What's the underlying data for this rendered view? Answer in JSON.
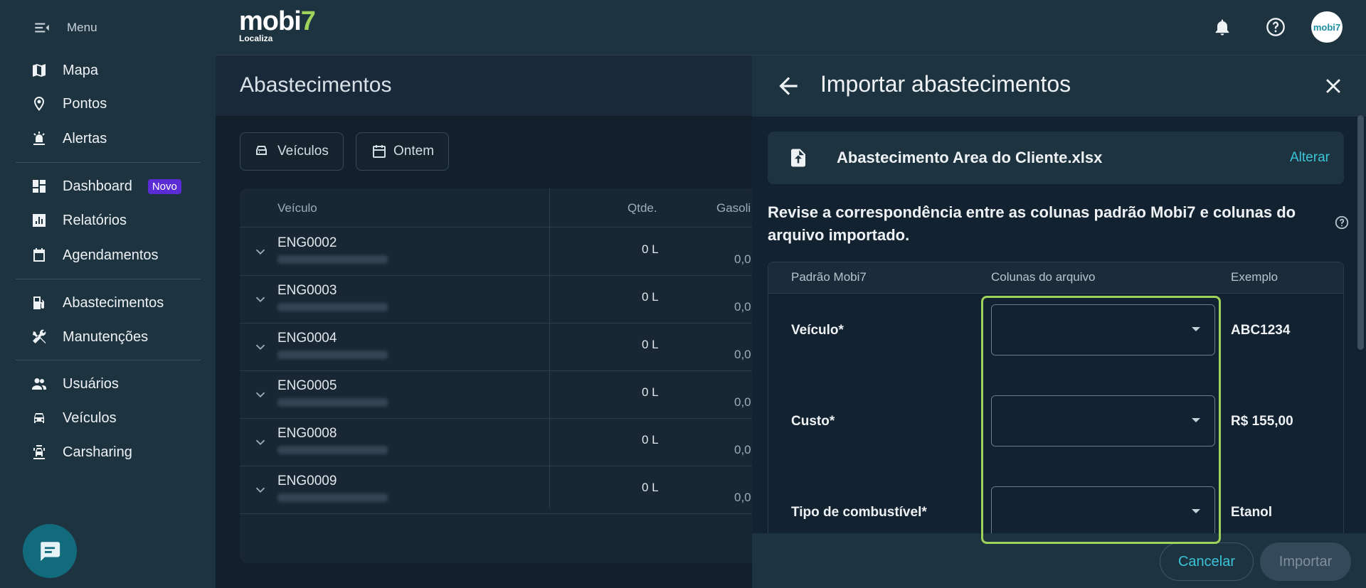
{
  "sidebar": {
    "menu_label": "Menu",
    "items": [
      {
        "label": "Mapa",
        "icon": "map-icon"
      },
      {
        "label": "Pontos",
        "icon": "pin-icon"
      },
      {
        "label": "Alertas",
        "icon": "alarm-icon"
      },
      {
        "label": "Dashboard",
        "icon": "dashboard-icon",
        "badge": "Novo"
      },
      {
        "label": "Relatórios",
        "icon": "report-icon"
      },
      {
        "label": "Agendamentos",
        "icon": "calendar-icon"
      },
      {
        "label": "Abastecimentos",
        "icon": "fuel-icon"
      },
      {
        "label": "Manutenções",
        "icon": "tools-icon"
      },
      {
        "label": "Usuários",
        "icon": "users-icon"
      },
      {
        "label": "Veículos",
        "icon": "car-icon"
      },
      {
        "label": "Carsharing",
        "icon": "carsharing-icon"
      }
    ]
  },
  "topbar": {
    "logo_text": "mobi",
    "logo_seven": "7",
    "logo_sub": "Localiza",
    "avatar_text": "mobi7"
  },
  "page": {
    "title": "Abastecimentos",
    "filters": [
      "Veículos",
      "Ontem"
    ]
  },
  "table": {
    "headers": [
      "Veículo",
      "Qtde.",
      "Gasoli"
    ],
    "rows": [
      {
        "code": "ENG0002",
        "qtd": "0 L",
        "gas": "0,0"
      },
      {
        "code": "ENG0003",
        "qtd": "0 L",
        "gas": "0,0"
      },
      {
        "code": "ENG0004",
        "qtd": "0 L",
        "gas": "0,0"
      },
      {
        "code": "ENG0005",
        "qtd": "0 L",
        "gas": "0,0"
      },
      {
        "code": "ENG0008",
        "qtd": "0 L",
        "gas": "0,0"
      },
      {
        "code": "ENG0009",
        "qtd": "0 L",
        "gas": "0,0"
      }
    ]
  },
  "drawer": {
    "title": "Importar abastecimentos",
    "file_name": "Abastecimento Area do Cliente.xlsx",
    "file_change": "Alterar",
    "description": "Revise a correspondência entre as colunas padrão Mobi7 e colunas do arquivo importado.",
    "headers": [
      "Padrão Mobi7",
      "Colunas do arquivo",
      "Exemplo"
    ],
    "mappings": [
      {
        "label": "Veículo*",
        "value": "",
        "example": "ABC1234"
      },
      {
        "label": "Custo*",
        "value": "",
        "example": "R$ 155,00"
      },
      {
        "label": "Tipo de combustível*",
        "value": "",
        "example": "Etanol"
      }
    ],
    "cancel_label": "Cancelar",
    "import_label": "Importar"
  },
  "colors": {
    "accent": "#3bc3d8",
    "brand_green": "#9fd25a",
    "badge": "#5b2bd6"
  }
}
